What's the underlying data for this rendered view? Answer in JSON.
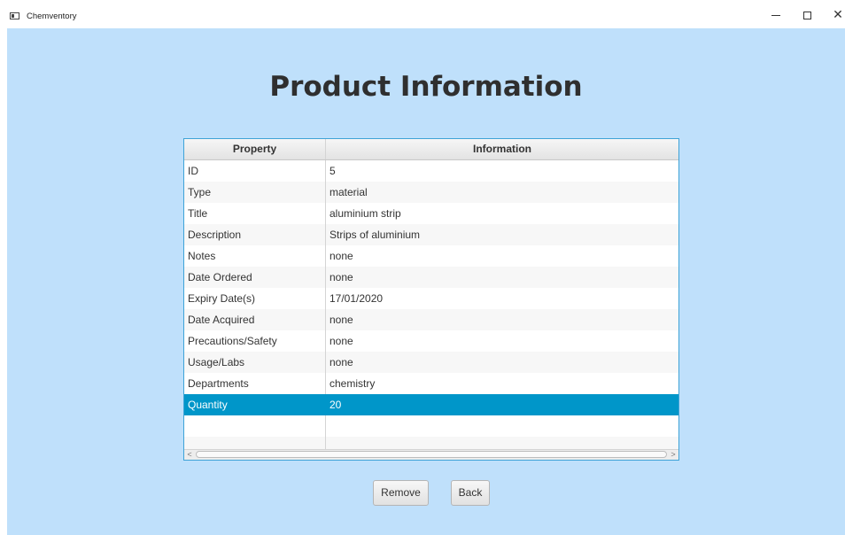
{
  "window": {
    "title": "Chemventory",
    "minimize_icon": "minimize-icon",
    "maximize_icon": "maximize-icon",
    "close_icon": "close-icon",
    "close_glyph": "✕"
  },
  "page": {
    "title": "Product Information"
  },
  "table": {
    "headers": [
      "Property",
      "Information"
    ],
    "rows": [
      [
        "ID",
        "5"
      ],
      [
        "Type",
        "material"
      ],
      [
        "Title",
        "aluminium strip"
      ],
      [
        "Description",
        "Strips of aluminium"
      ],
      [
        "Notes",
        "none"
      ],
      [
        "Date Ordered",
        "none"
      ],
      [
        "Expiry Date(s)",
        "17/01/2020"
      ],
      [
        "Date Acquired",
        "none"
      ],
      [
        "Precautions/Safety",
        "none"
      ],
      [
        "Usage/Labs",
        "none"
      ],
      [
        "Departments",
        "chemistry"
      ],
      [
        "Quantity",
        "20"
      ]
    ],
    "selected_row": 11,
    "selection_color": "#0096c9",
    "border_color": "#3fa3d7",
    "scroll_left_glyph": "<",
    "scroll_right_glyph": ">"
  },
  "buttons": {
    "remove": "Remove",
    "back": "Back"
  },
  "colors": {
    "background": "#bfe0fb",
    "title": "#2f2f2f"
  }
}
